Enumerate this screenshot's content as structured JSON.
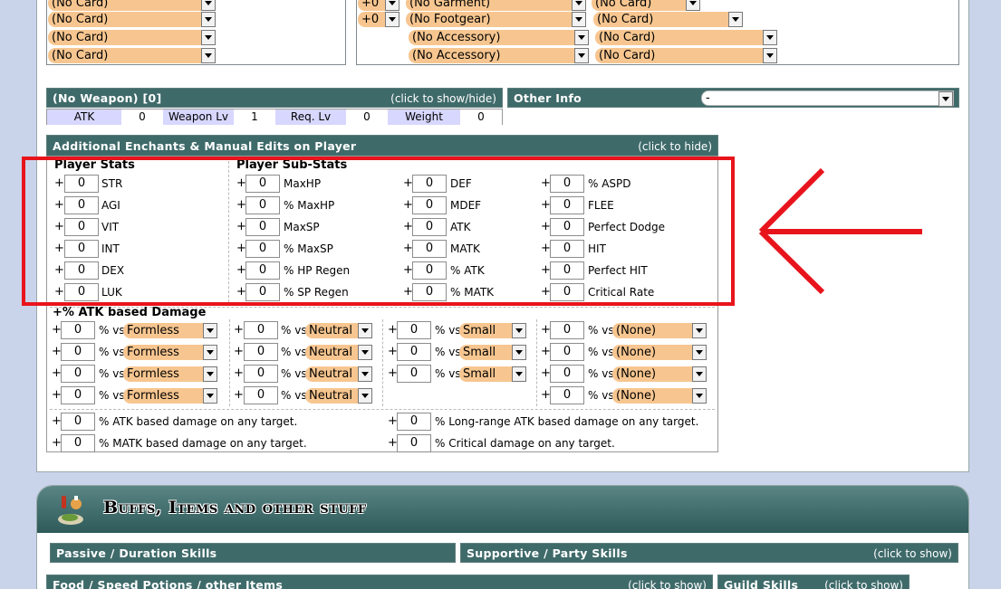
{
  "top_equip": {
    "left_cards": [
      "(No Card)",
      "(No Card)",
      "(No Card)",
      "(No Card)"
    ],
    "mid_refine": [
      "+0",
      "+0"
    ],
    "mid_items": [
      "(No Garment)",
      "(No Footgear)",
      "(No Accessory)",
      "(No Accessory)"
    ],
    "mid_cards": [
      "(No Card)",
      "(No Card)",
      "(No Card)",
      "(No Card)"
    ]
  },
  "weapon": {
    "title": "(No Weapon) [0]",
    "toggle": "(click to show/hide)",
    "atk_label": "ATK",
    "atk": "0",
    "wlv_label": "Weapon Lv",
    "wlv": "1",
    "req_label": "Req. Lv",
    "req": "0",
    "weight_label": "Weight",
    "weight": "0"
  },
  "other_info": {
    "title": "Other Info",
    "value": "-"
  },
  "enchants": {
    "title": "Additional Enchants & Manual Edits on Player",
    "toggle": "(click to hide)",
    "player_stats_header": "Player Stats",
    "sub_stats_header": "Player Sub-Stats",
    "stats": [
      {
        "value": "0",
        "label": "STR"
      },
      {
        "value": "0",
        "label": "AGI"
      },
      {
        "value": "0",
        "label": "VIT"
      },
      {
        "value": "0",
        "label": "INT"
      },
      {
        "value": "0",
        "label": "DEX"
      },
      {
        "value": "0",
        "label": "LUK"
      }
    ],
    "sub_col1": [
      {
        "value": "0",
        "label": "MaxHP"
      },
      {
        "value": "0",
        "label": "% MaxHP"
      },
      {
        "value": "0",
        "label": "MaxSP"
      },
      {
        "value": "0",
        "label": "% MaxSP"
      },
      {
        "value": "0",
        "label": "% HP Regen"
      },
      {
        "value": "0",
        "label": "% SP Regen"
      }
    ],
    "sub_col2": [
      {
        "value": "0",
        "label": "DEF"
      },
      {
        "value": "0",
        "label": "MDEF"
      },
      {
        "value": "0",
        "label": "ATK"
      },
      {
        "value": "0",
        "label": "MATK"
      },
      {
        "value": "0",
        "label": "% ATK"
      },
      {
        "value": "0",
        "label": "% MATK"
      }
    ],
    "sub_col3": [
      {
        "value": "0",
        "label": "% ASPD"
      },
      {
        "value": "0",
        "label": "FLEE"
      },
      {
        "value": "0",
        "label": "Perfect Dodge"
      },
      {
        "value": "0",
        "label": "HIT"
      },
      {
        "value": "0",
        "label": "Perfect HIT"
      },
      {
        "value": "0",
        "label": "Critical Rate"
      }
    ],
    "atk_damage_header": "+% ATK based Damage",
    "vs_label": "% vs",
    "race": [
      "Formless",
      "Formless",
      "Formless",
      "Formless"
    ],
    "element": [
      "Neutral",
      "Neutral",
      "Neutral",
      "Neutral"
    ],
    "size": [
      "Small",
      "Small",
      "Small"
    ],
    "monster": [
      "(None)",
      "(None)",
      "(None)",
      "(None)"
    ],
    "value": "0",
    "bottom": [
      {
        "value": "0",
        "label": "% ATK based damage on any target."
      },
      {
        "value": "0",
        "label": "% MATK based damage on any target."
      },
      {
        "value": "0",
        "label": "% Long-range ATK based damage on any target."
      },
      {
        "value": "0",
        "label": "% Critical damage on any target."
      }
    ]
  },
  "annotation": {
    "color": "#e8141c"
  },
  "buffs": {
    "title": "Buffs, Items and other stuff",
    "passive": "Passive / Duration Skills",
    "supportive": "Supportive / Party Skills",
    "supportive_toggle": "(click to show)",
    "food": "Food / Speed Potions / other Items",
    "food_toggle": "(click to show)",
    "guild": "Guild Skills",
    "guild_toggle": "(click to show)"
  }
}
